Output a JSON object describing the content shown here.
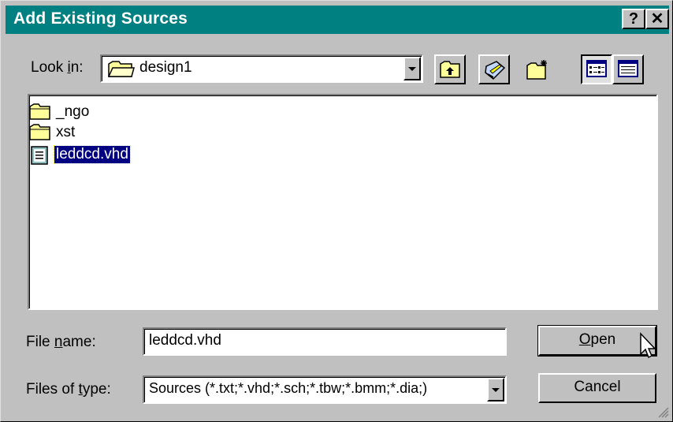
{
  "window": {
    "title": "Add Existing Sources",
    "help_label": "?",
    "close_label": "✕"
  },
  "lookin": {
    "label_prefix": "Look ",
    "label_accel": "i",
    "label_suffix": "n:",
    "value": "design1",
    "icon": "folder-icon"
  },
  "toolbar": {
    "up": "up-one-level-icon",
    "desktop": "desktop-icon",
    "new_folder": "new-folder-icon",
    "list_view": "list-view-icon",
    "details_view": "details-view-icon"
  },
  "files": [
    {
      "name": "_ngo",
      "kind": "folder"
    },
    {
      "name": "xst",
      "kind": "folder"
    },
    {
      "name": "leddcd.vhd",
      "kind": "file",
      "selected": true
    }
  ],
  "filename": {
    "label_prefix": "File ",
    "label_accel": "n",
    "label_suffix": "ame:",
    "value": "leddcd.vhd"
  },
  "filetype": {
    "label_prefix": "Files of ",
    "label_accel": "t",
    "label_suffix": "ype:",
    "value": "Sources (*.txt;*.vhd;*.sch;*.tbw;*.bmm;*.dia;)"
  },
  "buttons": {
    "open_accel": "O",
    "open_rest": "pen",
    "cancel": "Cancel"
  },
  "colors": {
    "titlebar": "#008080",
    "selection": "#000080",
    "face": "#c0c0c0"
  }
}
